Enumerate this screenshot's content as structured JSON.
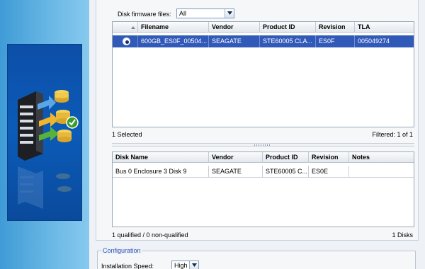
{
  "firmware_filter": {
    "label": "Disk firmware files:",
    "selected": "All"
  },
  "firmware_grid": {
    "columns": [
      "Filename",
      "Vendor",
      "Product ID",
      "Revision",
      "TLA"
    ],
    "rows": [
      {
        "filename": "600GB_ES0F_00504...",
        "vendor": "SEAGATE",
        "product_id": "STE60005 CLA...",
        "revision": "ES0F",
        "tla": "005049274",
        "selected": true
      }
    ],
    "status_left": "1 Selected",
    "status_right": "Filtered: 1 of 1"
  },
  "disk_grid": {
    "columns": [
      "Disk Name",
      "Vendor",
      "Product ID",
      "Revision",
      "Notes"
    ],
    "rows": [
      {
        "disk_name": "Bus 0 Enclosure 3 Disk 9",
        "vendor": "SEAGATE",
        "product_id": "STE60005 C...",
        "revision": "ES0E",
        "notes": ""
      }
    ],
    "status_left": "1 qualified / 0 non-qualified",
    "status_right": "1 Disks"
  },
  "configuration": {
    "legend": "Configuration",
    "install_speed_label": "Installation Speed:",
    "install_speed_value": "High"
  },
  "icons": {
    "banner": "server-disk-upgrade-icon",
    "dropdown": "chevron-down-icon",
    "sort": "sort-ascending-icon"
  },
  "colors": {
    "selection": "#3159b8",
    "banner": "#0b5bb8",
    "legend_text": "#2b54b8"
  }
}
